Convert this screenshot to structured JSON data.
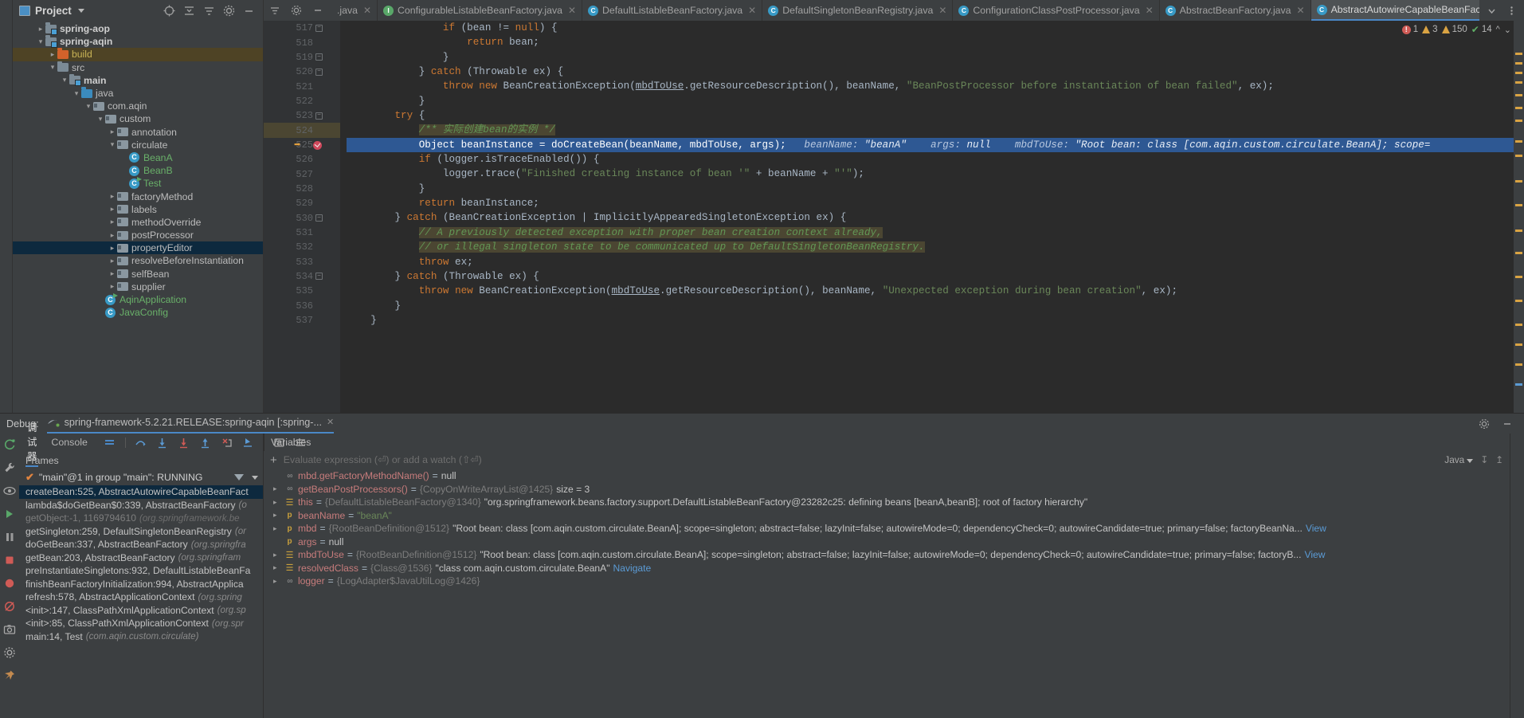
{
  "project": {
    "title": "Project",
    "tools": [
      "target-icon",
      "collapse-all-icon",
      "settings-view-icon",
      "gear-icon",
      "minimize-icon"
    ],
    "tree": [
      {
        "indent": 1,
        "arrow": "closed",
        "icon": "folder-module",
        "label": "spring-aop",
        "bold": true,
        "sel": ""
      },
      {
        "indent": 1,
        "arrow": "open",
        "icon": "folder-module",
        "label": "spring-aqin",
        "bold": true,
        "sel": ""
      },
      {
        "indent": 2,
        "arrow": "closed",
        "icon": "folder-orange",
        "label": "build",
        "bold": false,
        "sel": "brown",
        "color": "yellow"
      },
      {
        "indent": 2,
        "arrow": "open",
        "icon": "folder",
        "label": "src",
        "bold": false,
        "sel": ""
      },
      {
        "indent": 3,
        "arrow": "open",
        "icon": "folder-module",
        "label": "main",
        "bold": true,
        "sel": ""
      },
      {
        "indent": 4,
        "arrow": "open",
        "icon": "folder-blue",
        "label": "java",
        "bold": false,
        "sel": ""
      },
      {
        "indent": 5,
        "arrow": "open",
        "icon": "package",
        "label": "com.aqin",
        "bold": false,
        "sel": ""
      },
      {
        "indent": 6,
        "arrow": "open",
        "icon": "package",
        "label": "custom",
        "bold": false,
        "sel": ""
      },
      {
        "indent": 7,
        "arrow": "closed",
        "icon": "package",
        "label": "annotation",
        "bold": false,
        "sel": ""
      },
      {
        "indent": 7,
        "arrow": "open",
        "icon": "package",
        "label": "circulate",
        "bold": false,
        "sel": ""
      },
      {
        "indent": 8,
        "arrow": "none",
        "icon": "class",
        "label": "BeanA",
        "bold": false,
        "sel": "",
        "color": "green"
      },
      {
        "indent": 8,
        "arrow": "none",
        "icon": "class",
        "label": "BeanB",
        "bold": false,
        "sel": "",
        "color": "green"
      },
      {
        "indent": 8,
        "arrow": "none",
        "icon": "class-runnable",
        "label": "Test",
        "bold": false,
        "sel": "",
        "color": "green"
      },
      {
        "indent": 7,
        "arrow": "closed",
        "icon": "package",
        "label": "factoryMethod",
        "bold": false,
        "sel": ""
      },
      {
        "indent": 7,
        "arrow": "closed",
        "icon": "package",
        "label": "labels",
        "bold": false,
        "sel": ""
      },
      {
        "indent": 7,
        "arrow": "closed",
        "icon": "package",
        "label": "methodOverride",
        "bold": false,
        "sel": ""
      },
      {
        "indent": 7,
        "arrow": "closed",
        "icon": "package",
        "label": "postProcessor",
        "bold": false,
        "sel": ""
      },
      {
        "indent": 7,
        "arrow": "closed",
        "icon": "package",
        "label": "propertyEditor",
        "bold": false,
        "sel": "blue"
      },
      {
        "indent": 7,
        "arrow": "closed",
        "icon": "package",
        "label": "resolveBeforeInstantiation",
        "bold": false,
        "sel": ""
      },
      {
        "indent": 7,
        "arrow": "closed",
        "icon": "package",
        "label": "selfBean",
        "bold": false,
        "sel": ""
      },
      {
        "indent": 7,
        "arrow": "closed",
        "icon": "package",
        "label": "supplier",
        "bold": false,
        "sel": ""
      },
      {
        "indent": 6,
        "arrow": "none",
        "icon": "class-runnable",
        "label": "AqinApplication",
        "bold": false,
        "sel": "",
        "color": "green"
      },
      {
        "indent": 6,
        "arrow": "none",
        "icon": "class",
        "label": "JavaConfig",
        "bold": false,
        "sel": "",
        "color": "green"
      }
    ]
  },
  "tabs": [
    {
      "label": ".java",
      "kind": "none",
      "active": false
    },
    {
      "label": "ConfigurableListableBeanFactory.java",
      "kind": "interface",
      "active": false
    },
    {
      "label": "DefaultListableBeanFactory.java",
      "kind": "class",
      "active": false
    },
    {
      "label": "DefaultSingletonBeanRegistry.java",
      "kind": "class",
      "active": false
    },
    {
      "label": "ConfigurationClassPostProcessor.java",
      "kind": "class",
      "active": false
    },
    {
      "label": "AbstractBeanFactory.java",
      "kind": "class",
      "active": false
    },
    {
      "label": "AbstractAutowireCapableBeanFactory.java",
      "kind": "class",
      "active": true
    }
  ],
  "inspections": {
    "errors": "1",
    "warnings": "3",
    "weak_warnings": "150",
    "ok": "14"
  },
  "editor": {
    "first_line": 517,
    "lines": [
      {
        "n": 517,
        "indent": 16,
        "tokens": [
          [
            "kw",
            "if"
          ],
          [
            "id",
            " ("
          ],
          [
            "id",
            "bean"
          ],
          [
            "id",
            " != "
          ],
          [
            "kw",
            "null"
          ],
          [
            "id",
            ") {"
          ]
        ]
      },
      {
        "n": 518,
        "indent": 20,
        "tokens": [
          [
            "kw",
            "return"
          ],
          [
            "id",
            " bean;"
          ]
        ]
      },
      {
        "n": 519,
        "indent": 16,
        "tokens": [
          [
            "id",
            "}"
          ]
        ]
      },
      {
        "n": 520,
        "indent": 12,
        "tokens": [
          [
            "id",
            "} "
          ],
          [
            "kw",
            "catch"
          ],
          [
            "id",
            " ("
          ],
          [
            "id",
            "Throwable"
          ],
          [
            "id",
            " ex) {"
          ]
        ]
      },
      {
        "n": 521,
        "indent": 16,
        "tokens": [
          [
            "kw",
            "throw"
          ],
          [
            "id",
            " "
          ],
          [
            "kw",
            "new"
          ],
          [
            "id",
            " BeanCreationException("
          ],
          [
            "und",
            "mbdToUse"
          ],
          [
            "id",
            ".getResourceDescription(), beanName, "
          ],
          [
            "str",
            "\"BeanPostProcessor before instantiation of bean failed\""
          ],
          [
            "id",
            ", ex);"
          ]
        ]
      },
      {
        "n": 522,
        "indent": 12,
        "tokens": [
          [
            "id",
            "}"
          ]
        ]
      },
      {
        "n": 523,
        "indent": 8,
        "tokens": [
          [
            "kw",
            "try"
          ],
          [
            "id",
            " {"
          ]
        ]
      },
      {
        "n": 524,
        "indent": 12,
        "tokens": [
          [
            "cmt",
            "/** 实际创建bean的实例 */"
          ]
        ]
      },
      {
        "n": 525,
        "indent": 12,
        "exec": true,
        "tokens": [
          [
            "id",
            "Object beanInstance = doCreateBean(beanName, mbdToUse, args);"
          ],
          [
            "hint",
            "   beanName: "
          ],
          [
            "hint-b",
            "\"beanA\""
          ],
          [
            "hint",
            "    args: "
          ],
          [
            "hint-b",
            "null"
          ],
          [
            "hint",
            "    mbdToUse: "
          ],
          [
            "hint-b",
            "\"Root bean: class [com.aqin.custom.circulate.BeanA]; scope="
          ]
        ]
      },
      {
        "n": 526,
        "indent": 12,
        "tokens": [
          [
            "kw",
            "if"
          ],
          [
            "id",
            " (logger.isTraceEnabled()) {"
          ]
        ]
      },
      {
        "n": 527,
        "indent": 16,
        "tokens": [
          [
            "id",
            "logger.trace("
          ],
          [
            "str",
            "\"Finished creating instance of bean '\""
          ],
          [
            "id",
            " + beanName + "
          ],
          [
            "str",
            "\"'\""
          ],
          [
            "id",
            ");"
          ]
        ]
      },
      {
        "n": 528,
        "indent": 12,
        "tokens": [
          [
            "id",
            "}"
          ]
        ]
      },
      {
        "n": 529,
        "indent": 12,
        "tokens": [
          [
            "kw",
            "return"
          ],
          [
            "id",
            " beanInstance;"
          ]
        ]
      },
      {
        "n": 530,
        "indent": 8,
        "tokens": [
          [
            "id",
            "} "
          ],
          [
            "kw",
            "catch"
          ],
          [
            "id",
            " (BeanCreationException | ImplicitlyAppearedSingletonException ex) {"
          ]
        ]
      },
      {
        "n": 531,
        "indent": 12,
        "tokens": [
          [
            "cmt",
            "// A previously detected exception with proper bean creation context already,"
          ]
        ]
      },
      {
        "n": 532,
        "indent": 12,
        "tokens": [
          [
            "cmt",
            "// or illegal singleton state to be communicated up to DefaultSingletonBeanRegistry."
          ]
        ]
      },
      {
        "n": 533,
        "indent": 12,
        "tokens": [
          [
            "kw",
            "throw"
          ],
          [
            "id",
            " ex;"
          ]
        ]
      },
      {
        "n": 534,
        "indent": 8,
        "tokens": [
          [
            "id",
            "} "
          ],
          [
            "kw",
            "catch"
          ],
          [
            "id",
            " (Throwable ex) {"
          ]
        ]
      },
      {
        "n": 535,
        "indent": 12,
        "tokens": [
          [
            "kw",
            "throw"
          ],
          [
            "id",
            " "
          ],
          [
            "kw",
            "new"
          ],
          [
            "id",
            " BeanCreationException("
          ],
          [
            "und",
            "mbdToUse"
          ],
          [
            "id",
            ".getResourceDescription(), beanName, "
          ],
          [
            "str",
            "\"Unexpected exception during bean creation\""
          ],
          [
            "id",
            ", ex);"
          ]
        ]
      },
      {
        "n": 536,
        "indent": 8,
        "tokens": [
          [
            "id",
            "}"
          ]
        ]
      },
      {
        "n": 537,
        "indent": 4,
        "tokens": [
          [
            "id",
            "}"
          ]
        ]
      }
    ]
  },
  "debug": {
    "label": "Debug:",
    "config_name": "spring-framework-5.2.21.RELEASE:spring-aqin [:spring-...",
    "tabs": [
      {
        "label": "调试器",
        "active": true
      },
      {
        "label": "Console",
        "active": false
      }
    ],
    "frames_header": "Frames",
    "variables_header": "Variables",
    "thread": "\"main\"@1 in group \"main\": RUNNING",
    "evaluate_placeholder": "Evaluate expression (⏎) or add a watch (⇧⏎)",
    "language_selector": "Java",
    "frames": [
      {
        "text": "createBean:525, AbstractAutowireCapableBeanFact",
        "pkg": "",
        "sel": true,
        "dim": false
      },
      {
        "text": "lambda$doGetBean$0:339, AbstractBeanFactory",
        "pkg": "(o",
        "sel": false,
        "dim": false
      },
      {
        "text": "getObject:-1, 1169794610",
        "pkg": "(org.springframework.be",
        "sel": false,
        "dim": true
      },
      {
        "text": "getSingleton:259, DefaultSingletonBeanRegistry",
        "pkg": "(or",
        "sel": false,
        "dim": false
      },
      {
        "text": "doGetBean:337, AbstractBeanFactory",
        "pkg": "(org.springfra",
        "sel": false,
        "dim": false
      },
      {
        "text": "getBean:203, AbstractBeanFactory",
        "pkg": "(org.springfram",
        "sel": false,
        "dim": false
      },
      {
        "text": "preInstantiateSingletons:932, DefaultListableBeanFa",
        "pkg": "",
        "sel": false,
        "dim": false
      },
      {
        "text": "finishBeanFactoryInitialization:994, AbstractApplica",
        "pkg": "",
        "sel": false,
        "dim": false
      },
      {
        "text": "refresh:578, AbstractApplicationContext",
        "pkg": "(org.spring",
        "sel": false,
        "dim": false
      },
      {
        "text": "<init>:147, ClassPathXmlApplicationContext",
        "pkg": "(org.sp",
        "sel": false,
        "dim": false
      },
      {
        "text": "<init>:85, ClassPathXmlApplicationContext",
        "pkg": "(org.spr",
        "sel": false,
        "dim": false
      },
      {
        "text": "main:14, Test",
        "pkg": "(com.aqin.custom.circulate)",
        "sel": false,
        "dim": false
      }
    ],
    "variables": [
      {
        "expand": false,
        "icon": "method",
        "name": "mbd.getFactoryMethodName()",
        "eq": " = ",
        "type": "",
        "value": "null",
        "value_kind": "plain",
        "tail": ""
      },
      {
        "expand": true,
        "icon": "method",
        "name": "getBeanPostProcessors()",
        "eq": " = ",
        "type": "{CopyOnWriteArrayList@1425}",
        "value": "size = 3",
        "value_kind": "plain",
        "tail": ""
      },
      {
        "expand": true,
        "icon": "field",
        "name": "this",
        "eq": " = ",
        "type": "{DefaultListableBeanFactory@1340}",
        "value": "\"org.springframework.beans.factory.support.DefaultListableBeanFactory@23282c25: defining beans [beanA,beanB]; root of factory hierarchy\"",
        "value_kind": "plain",
        "tail": ""
      },
      {
        "expand": true,
        "icon": "param",
        "name": "beanName",
        "eq": " = ",
        "type": "",
        "value": "\"beanA\"",
        "value_kind": "string",
        "tail": ""
      },
      {
        "expand": true,
        "icon": "param",
        "name": "mbd",
        "eq": " = ",
        "type": "{RootBeanDefinition@1512}",
        "value": "\"Root bean: class [com.aqin.custom.circulate.BeanA]; scope=singleton; abstract=false; lazyInit=false; autowireMode=0; dependencyCheck=0; autowireCandidate=true; primary=false; factoryBeanNa...",
        "value_kind": "plain",
        "tail": "View"
      },
      {
        "expand": false,
        "icon": "param",
        "name": "args",
        "eq": " = ",
        "type": "",
        "value": "null",
        "value_kind": "plain",
        "tail": ""
      },
      {
        "expand": true,
        "icon": "field",
        "name": "mbdToUse",
        "eq": " = ",
        "type": "{RootBeanDefinition@1512}",
        "value": "\"Root bean: class [com.aqin.custom.circulate.BeanA]; scope=singleton; abstract=false; lazyInit=false; autowireMode=0; dependencyCheck=0; autowireCandidate=true; primary=false; factoryB...",
        "value_kind": "plain",
        "tail": "View"
      },
      {
        "expand": true,
        "icon": "field",
        "name": "resolvedClass",
        "eq": " = ",
        "type": "{Class@1536}",
        "value": "\"class com.aqin.custom.circulate.BeanA\"",
        "value_kind": "plain",
        "tail": "Navigate"
      },
      {
        "expand": true,
        "icon": "method",
        "name": "logger",
        "eq": " = ",
        "type": "{LogAdapter$JavaUtilLog@1426}",
        "value": "",
        "value_kind": "plain",
        "tail": ""
      }
    ]
  },
  "colors": {
    "accent": "#4a88c7",
    "exec_line": "#2e5893",
    "selection": "#0d293e",
    "bp": "#d0485c"
  }
}
